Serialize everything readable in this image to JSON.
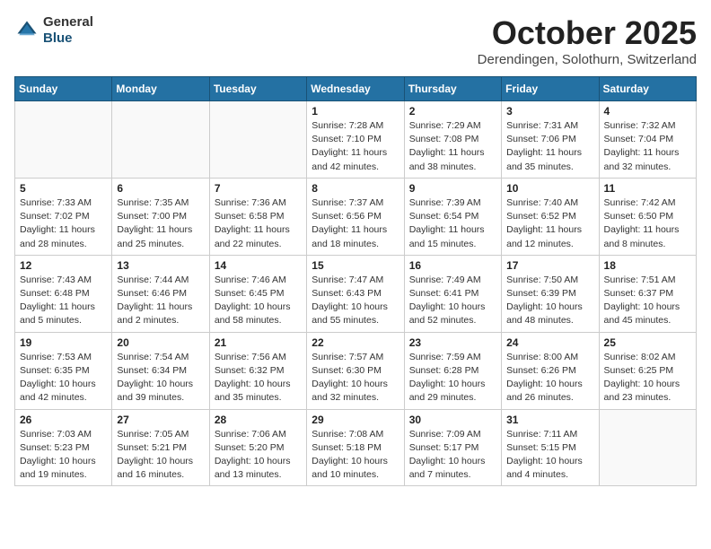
{
  "header": {
    "logo_general": "General",
    "logo_blue": "Blue",
    "month": "October 2025",
    "location": "Derendingen, Solothurn, Switzerland"
  },
  "weekdays": [
    "Sunday",
    "Monday",
    "Tuesday",
    "Wednesday",
    "Thursday",
    "Friday",
    "Saturday"
  ],
  "weeks": [
    [
      {
        "day": "",
        "info": ""
      },
      {
        "day": "",
        "info": ""
      },
      {
        "day": "",
        "info": ""
      },
      {
        "day": "1",
        "info": "Sunrise: 7:28 AM\nSunset: 7:10 PM\nDaylight: 11 hours\nand 42 minutes."
      },
      {
        "day": "2",
        "info": "Sunrise: 7:29 AM\nSunset: 7:08 PM\nDaylight: 11 hours\nand 38 minutes."
      },
      {
        "day": "3",
        "info": "Sunrise: 7:31 AM\nSunset: 7:06 PM\nDaylight: 11 hours\nand 35 minutes."
      },
      {
        "day": "4",
        "info": "Sunrise: 7:32 AM\nSunset: 7:04 PM\nDaylight: 11 hours\nand 32 minutes."
      }
    ],
    [
      {
        "day": "5",
        "info": "Sunrise: 7:33 AM\nSunset: 7:02 PM\nDaylight: 11 hours\nand 28 minutes."
      },
      {
        "day": "6",
        "info": "Sunrise: 7:35 AM\nSunset: 7:00 PM\nDaylight: 11 hours\nand 25 minutes."
      },
      {
        "day": "7",
        "info": "Sunrise: 7:36 AM\nSunset: 6:58 PM\nDaylight: 11 hours\nand 22 minutes."
      },
      {
        "day": "8",
        "info": "Sunrise: 7:37 AM\nSunset: 6:56 PM\nDaylight: 11 hours\nand 18 minutes."
      },
      {
        "day": "9",
        "info": "Sunrise: 7:39 AM\nSunset: 6:54 PM\nDaylight: 11 hours\nand 15 minutes."
      },
      {
        "day": "10",
        "info": "Sunrise: 7:40 AM\nSunset: 6:52 PM\nDaylight: 11 hours\nand 12 minutes."
      },
      {
        "day": "11",
        "info": "Sunrise: 7:42 AM\nSunset: 6:50 PM\nDaylight: 11 hours\nand 8 minutes."
      }
    ],
    [
      {
        "day": "12",
        "info": "Sunrise: 7:43 AM\nSunset: 6:48 PM\nDaylight: 11 hours\nand 5 minutes."
      },
      {
        "day": "13",
        "info": "Sunrise: 7:44 AM\nSunset: 6:46 PM\nDaylight: 11 hours\nand 2 minutes."
      },
      {
        "day": "14",
        "info": "Sunrise: 7:46 AM\nSunset: 6:45 PM\nDaylight: 10 hours\nand 58 minutes."
      },
      {
        "day": "15",
        "info": "Sunrise: 7:47 AM\nSunset: 6:43 PM\nDaylight: 10 hours\nand 55 minutes."
      },
      {
        "day": "16",
        "info": "Sunrise: 7:49 AM\nSunset: 6:41 PM\nDaylight: 10 hours\nand 52 minutes."
      },
      {
        "day": "17",
        "info": "Sunrise: 7:50 AM\nSunset: 6:39 PM\nDaylight: 10 hours\nand 48 minutes."
      },
      {
        "day": "18",
        "info": "Sunrise: 7:51 AM\nSunset: 6:37 PM\nDaylight: 10 hours\nand 45 minutes."
      }
    ],
    [
      {
        "day": "19",
        "info": "Sunrise: 7:53 AM\nSunset: 6:35 PM\nDaylight: 10 hours\nand 42 minutes."
      },
      {
        "day": "20",
        "info": "Sunrise: 7:54 AM\nSunset: 6:34 PM\nDaylight: 10 hours\nand 39 minutes."
      },
      {
        "day": "21",
        "info": "Sunrise: 7:56 AM\nSunset: 6:32 PM\nDaylight: 10 hours\nand 35 minutes."
      },
      {
        "day": "22",
        "info": "Sunrise: 7:57 AM\nSunset: 6:30 PM\nDaylight: 10 hours\nand 32 minutes."
      },
      {
        "day": "23",
        "info": "Sunrise: 7:59 AM\nSunset: 6:28 PM\nDaylight: 10 hours\nand 29 minutes."
      },
      {
        "day": "24",
        "info": "Sunrise: 8:00 AM\nSunset: 6:26 PM\nDaylight: 10 hours\nand 26 minutes."
      },
      {
        "day": "25",
        "info": "Sunrise: 8:02 AM\nSunset: 6:25 PM\nDaylight: 10 hours\nand 23 minutes."
      }
    ],
    [
      {
        "day": "26",
        "info": "Sunrise: 7:03 AM\nSunset: 5:23 PM\nDaylight: 10 hours\nand 19 minutes."
      },
      {
        "day": "27",
        "info": "Sunrise: 7:05 AM\nSunset: 5:21 PM\nDaylight: 10 hours\nand 16 minutes."
      },
      {
        "day": "28",
        "info": "Sunrise: 7:06 AM\nSunset: 5:20 PM\nDaylight: 10 hours\nand 13 minutes."
      },
      {
        "day": "29",
        "info": "Sunrise: 7:08 AM\nSunset: 5:18 PM\nDaylight: 10 hours\nand 10 minutes."
      },
      {
        "day": "30",
        "info": "Sunrise: 7:09 AM\nSunset: 5:17 PM\nDaylight: 10 hours\nand 7 minutes."
      },
      {
        "day": "31",
        "info": "Sunrise: 7:11 AM\nSunset: 5:15 PM\nDaylight: 10 hours\nand 4 minutes."
      },
      {
        "day": "",
        "info": ""
      }
    ]
  ]
}
